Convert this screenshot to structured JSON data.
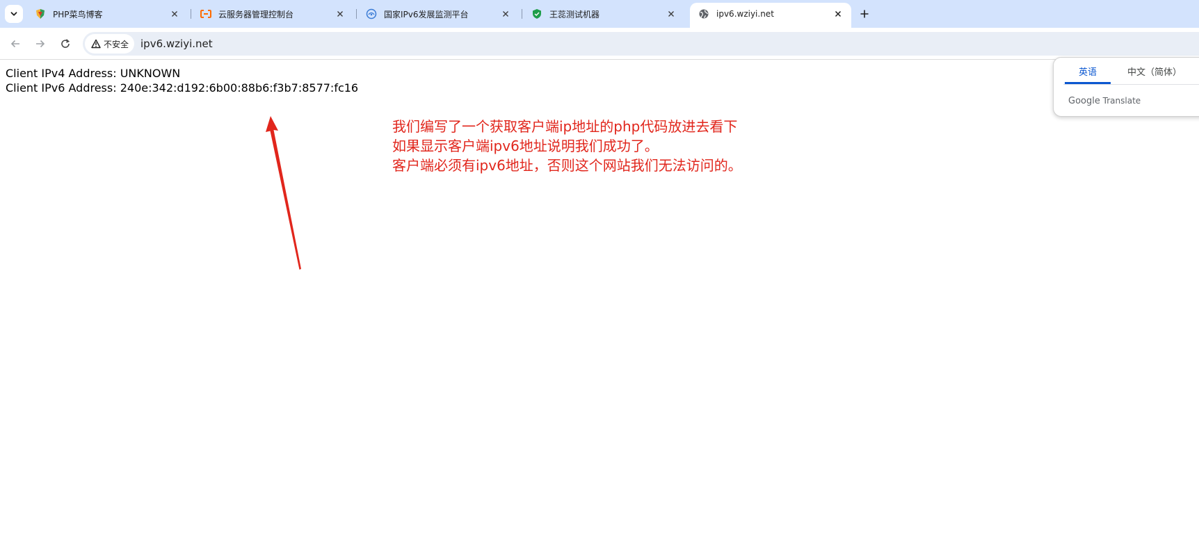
{
  "browser": {
    "tabs": [
      {
        "title": "PHP菜鸟博客",
        "icon": "php-blog-favicon-icon",
        "active": false
      },
      {
        "title": "云服务器管理控制台",
        "icon": "aliyun-favicon-icon",
        "active": false
      },
      {
        "title": "国家IPv6发展监测平台",
        "icon": "ipv6-monitor-favicon-icon",
        "active": false
      },
      {
        "title": "王蕊测试机器",
        "icon": "shield-favicon-icon",
        "active": false
      },
      {
        "title": "ipv6.wziyi.net",
        "icon": "globe-icon",
        "active": true
      }
    ],
    "security_label": "不安全",
    "url": "ipv6.wziyi.net"
  },
  "page": {
    "ipv4_line": "Client IPv4 Address: UNKNOWN",
    "ipv6_line": "Client IPv6 Address: 240e:342:d192:6b00:88b6:f3b7:8577:fc16"
  },
  "annotation": {
    "lines": [
      "我们编写了一个获取客户端ip地址的php代码放进去看下",
      "如果显示客户端ipv6地址说明我们成功了。",
      "客户端必须有ipv6地址，否则这个网站我们无法访问的。"
    ],
    "color": "#e1261c"
  },
  "translate_popup": {
    "source_lang": "英语",
    "target_lang": "中文（简体）",
    "brand": "Google",
    "product": "Translate",
    "accent": "#0b57d0"
  }
}
